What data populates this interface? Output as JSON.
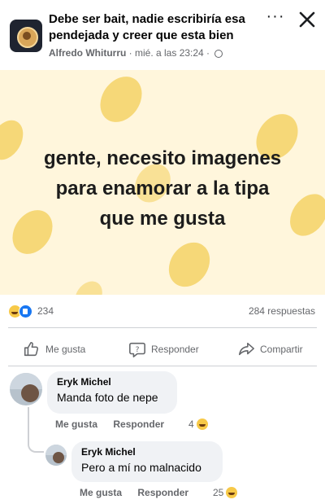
{
  "post": {
    "title": "Debe ser bait, nadie escribiría esa pendejada y creer que esta bien",
    "author": "Alfredo Whiturru",
    "timestamp": "· mié. a las 23:24 ·",
    "privacy_icon": "globe-icon",
    "more_icon": "more-horizontal-icon",
    "close_icon": "close-icon"
  },
  "image": {
    "lines": [
      "gente, necesito imagenes",
      "para enamorar a la tipa",
      "que me gusta"
    ],
    "background_color": "#fff6dc",
    "blob_color": "#f6d878"
  },
  "stats": {
    "reaction_count": "234",
    "reply_count": "284 respuestas",
    "reaction_icons": [
      "haha-reaction-icon",
      "like-reaction-icon"
    ]
  },
  "actions": {
    "like": "Me gusta",
    "reply": "Responder",
    "share": "Compartir"
  },
  "comments": [
    {
      "name": "Eryk Michel",
      "text": "Manda foto de nepe",
      "like_label": "Me gusta",
      "reply_label": "Responder",
      "reactions": "4"
    },
    {
      "name": "Eryk Michel",
      "text": "Pero a mí no malnacido",
      "like_label": "Me gusta",
      "reply_label": "Responder",
      "reactions": "25"
    }
  ],
  "colors": {
    "secondary_text": "#65676b",
    "bubble": "#f0f2f5",
    "like_blue": "#1877f2",
    "haha_yellow": "#f7c948"
  }
}
